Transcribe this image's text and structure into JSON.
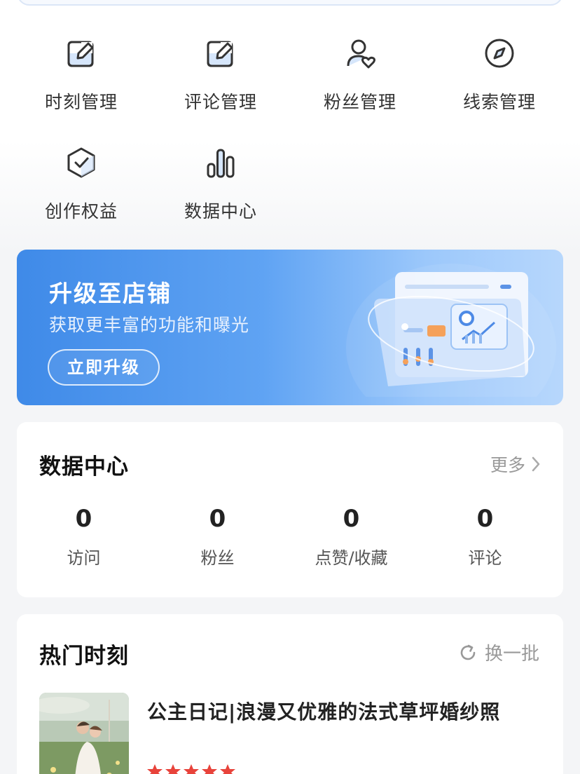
{
  "quick_menu": {
    "items": [
      {
        "label": "时刻管理",
        "icon": "edit-icon"
      },
      {
        "label": "评论管理",
        "icon": "edit-icon"
      },
      {
        "label": "粉丝管理",
        "icon": "user-heart-icon"
      },
      {
        "label": "线索管理",
        "icon": "compass-icon"
      },
      {
        "label": "创作权益",
        "icon": "shield-check-icon"
      },
      {
        "label": "数据中心",
        "icon": "bar-chart-icon"
      }
    ]
  },
  "banner": {
    "title": "升级至店铺",
    "subtitle": "获取更丰富的功能和曝光",
    "button": "立即升级"
  },
  "data_center": {
    "title": "数据中心",
    "more": "更多",
    "stats": [
      {
        "value": "0",
        "label": "访问"
      },
      {
        "value": "0",
        "label": "粉丝"
      },
      {
        "value": "0",
        "label": "点赞/收藏"
      },
      {
        "value": "0",
        "label": "评论"
      }
    ]
  },
  "hot_moments": {
    "title": "热门时刻",
    "refresh": "换一批",
    "posts": [
      {
        "title": "公主日记|浪漫又优雅的法式草坪婚纱照"
      }
    ]
  },
  "colors": {
    "banner_start": "#3f8ae8",
    "banner_end": "#b7d7fc",
    "icon_stroke": "#333333",
    "icon_fill": "#d6e6fb",
    "star": "#e8433b"
  }
}
